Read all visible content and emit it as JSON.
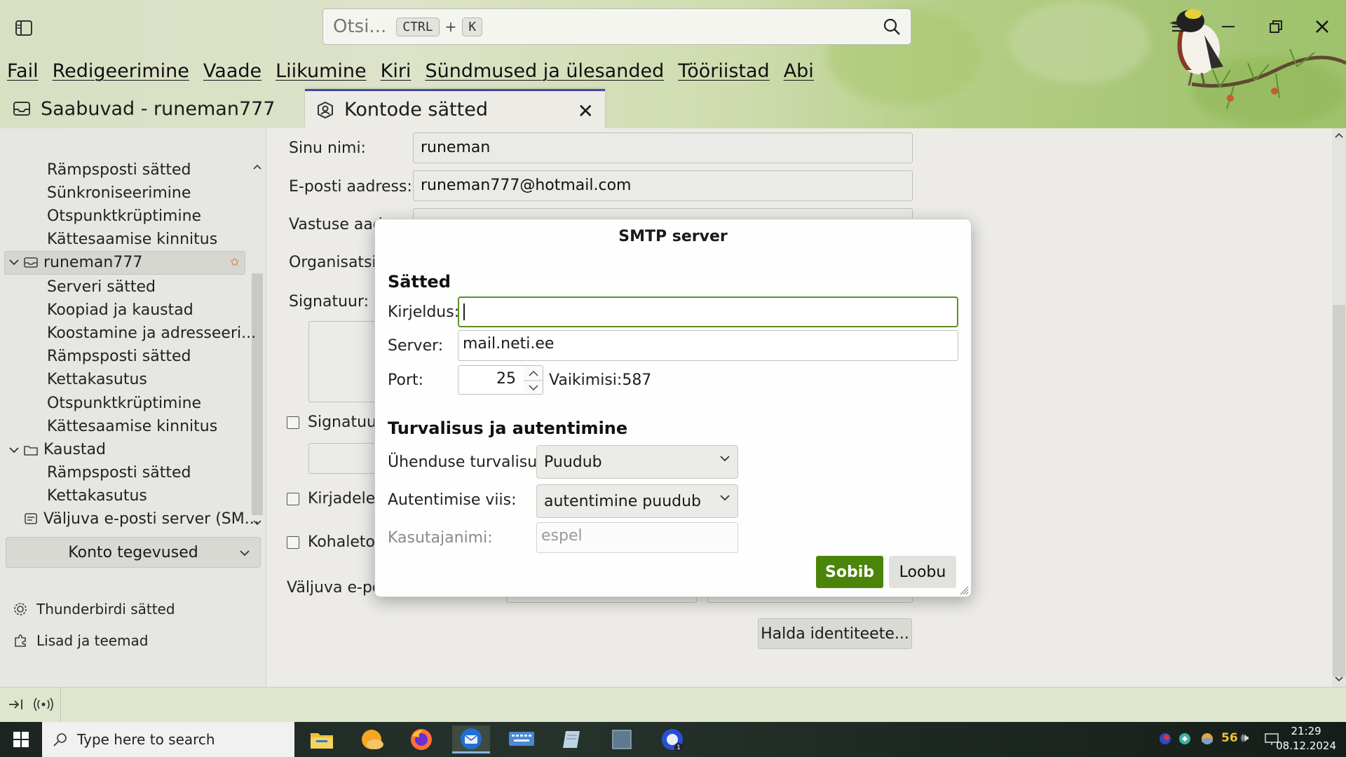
{
  "window": {
    "search_placeholder": "Otsi...",
    "search_shortcut_1": "CTRL",
    "search_shortcut_plus": "+",
    "search_shortcut_2": "K"
  },
  "menubar": {
    "items": [
      "Fail",
      "Redigeerimine",
      "Vaade",
      "Liikumine",
      "Kiri",
      "Sündmused ja ülesanded",
      "Tööriistad",
      "Abi"
    ]
  },
  "tabs": [
    {
      "label": "Saabuvad - runeman777"
    },
    {
      "label": "Kontode sätted"
    }
  ],
  "sidebar": {
    "items": [
      "Rämpsposti sätted",
      "Sünkroniseerimine",
      "Otspunktkrüptimine",
      "Kättesaamise kinnitus",
      "runeman777",
      "Serveri sätted",
      "Koopiad ja kaustad",
      "Koostamine ja adresseeri...",
      "Rämpsposti sätted",
      "Kettakasutus",
      "Otspunktkrüptimine",
      "Kättesaamise kinnitus",
      "Kaustad",
      "Rämpsposti sätted",
      "Kettakasutus",
      "Väljuva e-posti server (SM..."
    ],
    "account_actions": "Konto tegevused",
    "thunderbird_settings": "Thunderbirdi sätted",
    "addons": "Lisad ja teemad"
  },
  "main": {
    "name_label": "Sinu nimi:",
    "name_value": "runeman",
    "email_label": "E-posti aadress:",
    "email_value": "runeman777@hotmail.com",
    "reply_label": "Vastuse aadr",
    "org_label": "Organisatsio",
    "signature_label": "Signatuur:",
    "sig_check_label": "Signatuur",
    "kirjadele_label": "Kirjadele",
    "kohaletoim_label": "Kohaletoim",
    "outgoing_label": "Väljuva e-pos",
    "manage_identities": "Halda identiteete..."
  },
  "dialog": {
    "title": "SMTP server",
    "section_settings": "Sätted",
    "desc_label": "Kirjeldus:",
    "desc_value": "",
    "server_label": "Server:",
    "server_value": "mail.neti.ee",
    "port_label": "Port:",
    "port_value": "25",
    "port_default": "Vaikimisi:587",
    "section_security": "Turvalisus ja autentimine",
    "conn_security_label": "Ühenduse turvalisus:",
    "conn_security_value": "Puudub",
    "auth_label": "Autentimise viis:",
    "auth_value": "autentimine puudub",
    "username_label": "Kasutajanimi:",
    "username_placeholder": "espel",
    "ok_button": "Sobib",
    "cancel_button": "Loobu"
  },
  "taskbar": {
    "search_placeholder": "Type here to search",
    "tray_temp": "56",
    "time": "21:29",
    "date": "08.12.2024"
  },
  "colors": {
    "accent_green": "#4a8409",
    "focus_border": "#5f8f24",
    "tab_active_border": "#3e4aa0"
  }
}
